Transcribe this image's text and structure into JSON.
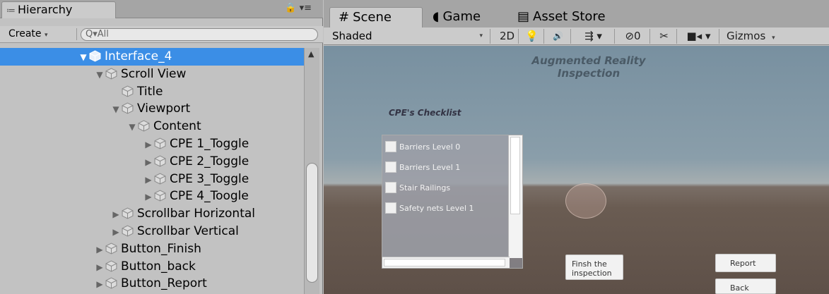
{
  "hierarchy": {
    "tab_icon": "≔",
    "tab_label": "Hierarchy",
    "lock_icon": "🔒 ▾≡",
    "create_label": "Create",
    "create_arrow": "▾",
    "search_value": "All",
    "search_icon": "Q▾",
    "items": [
      {
        "label": "Interface_4",
        "indent": 0,
        "expanded": true,
        "selected": true
      },
      {
        "label": "Scroll View",
        "indent": 1,
        "expanded": true,
        "selected": false
      },
      {
        "label": "Title",
        "indent": 2,
        "expanded": null,
        "selected": false
      },
      {
        "label": "Viewport",
        "indent": 2,
        "expanded": true,
        "selected": false
      },
      {
        "label": "Content",
        "indent": 3,
        "expanded": true,
        "selected": false
      },
      {
        "label": "CPE 1_Toggle",
        "indent": 4,
        "expanded": false,
        "selected": false
      },
      {
        "label": "CPE 2_Toggle",
        "indent": 4,
        "expanded": false,
        "selected": false
      },
      {
        "label": "CPE 3_Toggle",
        "indent": 4,
        "expanded": false,
        "selected": false
      },
      {
        "label": "CPE 4_Toogle",
        "indent": 4,
        "expanded": false,
        "selected": false
      },
      {
        "label": "Scrollbar Horizontal",
        "indent": 2,
        "expanded": false,
        "selected": false
      },
      {
        "label": "Scrollbar Vertical",
        "indent": 2,
        "expanded": false,
        "selected": false
      },
      {
        "label": "Button_Finish",
        "indent": 1,
        "expanded": false,
        "selected": false
      },
      {
        "label": "Button_back",
        "indent": 1,
        "expanded": false,
        "selected": false
      },
      {
        "label": "Button_Report",
        "indent": 1,
        "expanded": false,
        "selected": false
      }
    ]
  },
  "scene": {
    "tabs": [
      {
        "icon": "#",
        "label": "Scene"
      },
      {
        "icon": "◖",
        "label": "Game"
      },
      {
        "icon": "▤",
        "label": "Asset Store"
      }
    ],
    "shading_mode": "Shaded",
    "shading_arrow": "▾",
    "toolbar": {
      "mode_2d": "2D",
      "light_icon": "💡",
      "audio_icon": "🔊",
      "effects_icon": "⇶ ▾",
      "hidden_count": "⊘0",
      "tools_icon": "✂",
      "camera_icon": "■◂ ▾",
      "gizmos": "Gizmos",
      "gizmos_arrow": "▾"
    },
    "game_ui": {
      "title_line1": "Augmented Reality",
      "title_line2": "Inspection",
      "checklist_title": "CPE's Checklist",
      "checklist_items": [
        "Barriers Level 0",
        "Barriers Level 1",
        "Stair Railings",
        "Safety nets Level 1"
      ],
      "finish_line1": "Finsh the",
      "finish_line2": "inspection",
      "report": "Report",
      "back": "Back"
    }
  },
  "colors": {
    "selection": "#3b8ee6",
    "panel": "#c2c2c2",
    "tabbar": "#a5a5a5"
  }
}
